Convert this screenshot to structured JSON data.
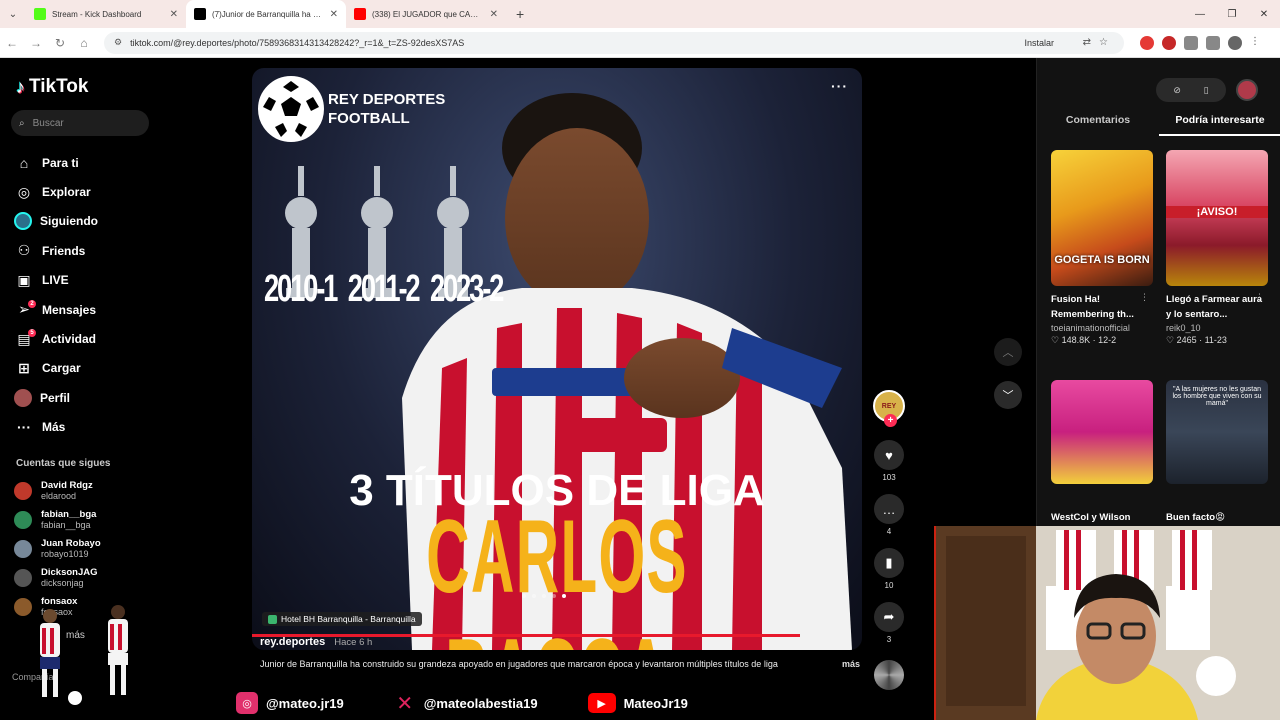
{
  "browser": {
    "tabs": [
      {
        "title": "Stream - Kick Dashboard",
        "fav": "#53fc18"
      },
      {
        "title": "(7)Junior de Barranquilla ha cor",
        "fav": "#000000"
      },
      {
        "title": "(338) El JUGADOR que CAMBIÓ",
        "fav": "#ff0000"
      }
    ],
    "url": "tiktok.com/@rey.deportes/photo/7589368314313428242?_r=1&_t=ZS-92desXS7AS",
    "install_label": "Instalar"
  },
  "tiktok": {
    "logo": "TikTok",
    "search_placeholder": "Buscar",
    "menu": [
      {
        "label": "Para ti",
        "icon": "home-icon"
      },
      {
        "label": "Explorar",
        "icon": "compass-icon"
      },
      {
        "label": "Siguiendo",
        "icon": "following-avatar-icon"
      },
      {
        "label": "Friends",
        "icon": "friends-icon"
      },
      {
        "label": "LIVE",
        "icon": "live-icon"
      },
      {
        "label": "Mensajes",
        "icon": "messages-icon",
        "badge": "2"
      },
      {
        "label": "Actividad",
        "icon": "activity-icon",
        "badge": "5"
      },
      {
        "label": "Cargar",
        "icon": "upload-icon"
      },
      {
        "label": "Perfil",
        "icon": "profile-icon"
      },
      {
        "label": "Más",
        "icon": "more-icon"
      }
    ],
    "follows_title": "Cuentas que sigues",
    "follows": [
      {
        "name": "David Rdgz",
        "handle": "eldarood",
        "color": "#c0392b"
      },
      {
        "name": "fabian__bga",
        "handle": "fabian__bga",
        "color": "#2e8b57"
      },
      {
        "name": "Juan Robayo",
        "handle": "robayo1019",
        "color": "#778899"
      },
      {
        "name": "DicksonJAG",
        "handle": "dicksonjag",
        "color": "#555555"
      },
      {
        "name": "fonsaox",
        "handle": "fonsaox",
        "color": "#8b5a2b"
      }
    ],
    "ver_mas": "más",
    "compania": "Compañía"
  },
  "post": {
    "brand_line1": "REY DEPORTES",
    "brand_line2": "FOOTBALL",
    "years": [
      "2010-1",
      "2011-2",
      "2023-2"
    ],
    "headline": "3 TÍTULOS DE LIGA",
    "player_name": "CARLOS BACCA",
    "location": "Hotel BH Barranquilla - Barranquilla",
    "author": "rey.deportes",
    "ago": "Hace 6 h",
    "description": "Junior de Barranquilla ha construido su grandeza apoyado en jugadores que marcaron época y levantaron múltiples títulos de liga",
    "more": "más",
    "avatar_text": "REY",
    "likes": "103",
    "comments": "4",
    "saves": "10",
    "shares": "3"
  },
  "right": {
    "tab_comments": "Comentarios",
    "tab_interest": "Podría interesarte",
    "cards": [
      {
        "title": "Fusion Ha! Remembering th...",
        "author": "toeianimationofficial",
        "stats": "♡ 148.8K · 12-2",
        "overlay": "GOGETA IS BORN"
      },
      {
        "title": "Llegó a Farmear aura y lo sentaro...",
        "author": "reik0_10",
        "stats": "♡ 2465 · 11-23",
        "overlay": "¡AVISO!"
      },
      {
        "title": "WestCol y Wilson",
        "author": "",
        "stats": "",
        "overlay": ""
      },
      {
        "title": "Buen facto😡",
        "author": "",
        "stats": "",
        "overlay": "\"A las mujeres no les gustan los hombre que viven con su mamá\""
      }
    ]
  },
  "stream": {
    "socials": [
      {
        "handle": "@mateo.jr19",
        "icon": "instagram-icon",
        "color": "#e1306c"
      },
      {
        "handle": "@mateolabestia19",
        "icon": "x-icon",
        "color": "#e0245e"
      },
      {
        "handle": "MateoJr19",
        "icon": "youtube-icon",
        "color": "#ff0000"
      }
    ]
  }
}
